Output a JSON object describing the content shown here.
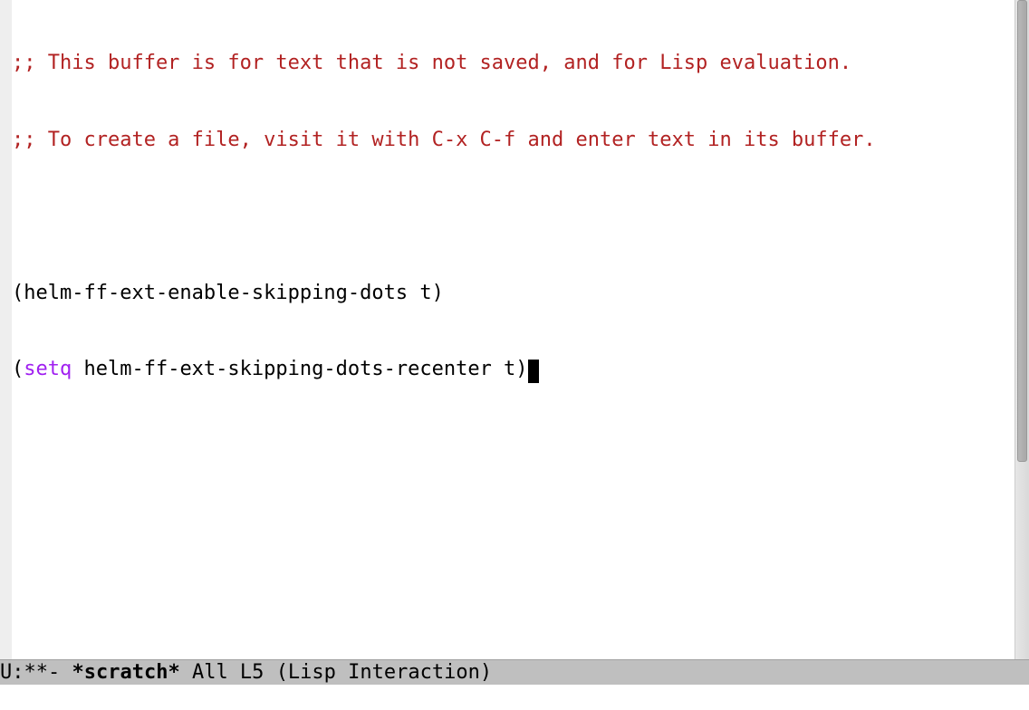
{
  "editor": {
    "comment_line1": ";; This buffer is for text that is not saved, and for Lisp evaluation.",
    "comment_line2": ";; To create a file, visit it with C-x C-f and enter text in its buffer.",
    "code_line1": "(helm-ff-ext-enable-skipping-dots t)",
    "code_line2_open": "(",
    "code_line2_keyword": "setq",
    "code_line2_rest": " helm-ff-ext-skipping-dots-recenter t)"
  },
  "mode_line": {
    "status": " U:**-  ",
    "buffer_name": "*scratch*",
    "spacing1": "       ",
    "position": "All L5",
    "spacing2": "     ",
    "mode": "(Lisp Interaction)"
  },
  "minibuffer": {
    "content": ""
  }
}
